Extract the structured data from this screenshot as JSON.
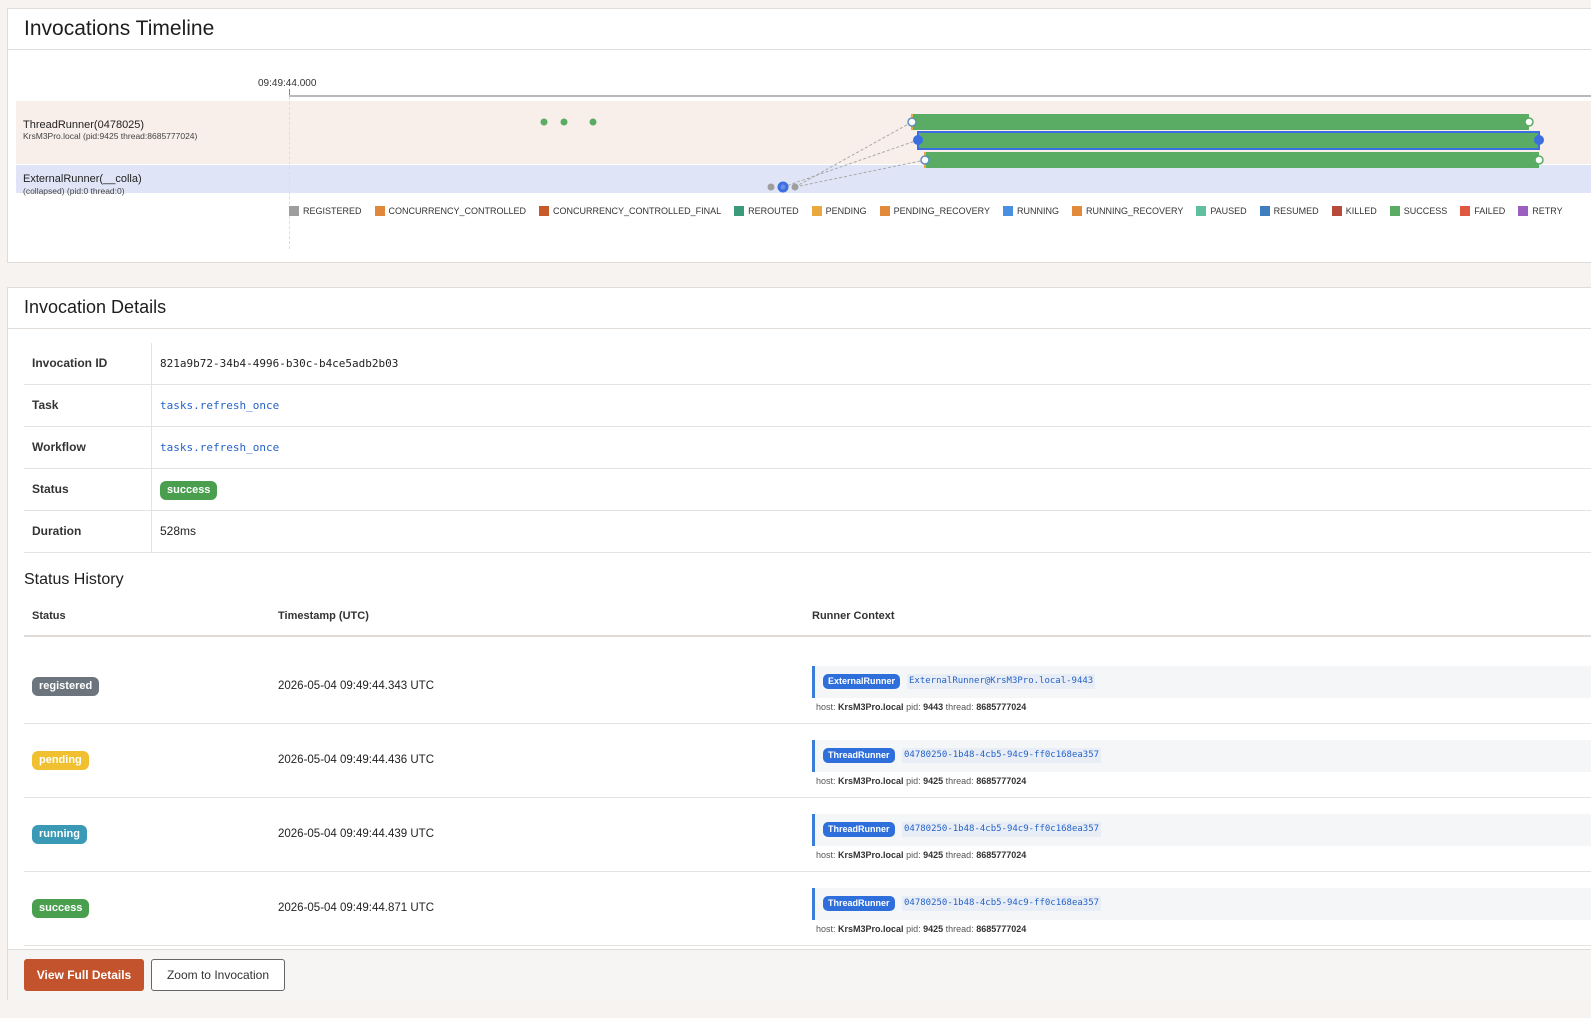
{
  "timeline": {
    "title": "Invocations Timeline",
    "start_time_label": "09:49:44.000",
    "lanes": [
      {
        "title": "ThreadRunner(0478025)",
        "subtitle": "KrsM3Pro.local (pid:9425 thread:8685777024)"
      },
      {
        "title": "ExternalRunner(__colla)",
        "subtitle": "(collapsed) (pid:0 thread:0)"
      }
    ],
    "legend": [
      {
        "label": "REGISTERED",
        "color": "#9e9e9e"
      },
      {
        "label": "CONCURRENCY_CONTROLLED",
        "color": "#e0883a"
      },
      {
        "label": "CONCURRENCY_CONTROLLED_FINAL",
        "color": "#c65a28"
      },
      {
        "label": "REROUTED",
        "color": "#3a9a7a"
      },
      {
        "label": "PENDING",
        "color": "#e9a93f"
      },
      {
        "label": "PENDING_RECOVERY",
        "color": "#e08a3a"
      },
      {
        "label": "RUNNING",
        "color": "#4a90e2"
      },
      {
        "label": "RUNNING_RECOVERY",
        "color": "#e08a3a"
      },
      {
        "label": "PAUSED",
        "color": "#5fbf9f"
      },
      {
        "label": "RESUMED",
        "color": "#3f7fbf"
      },
      {
        "label": "KILLED",
        "color": "#b84a3a"
      },
      {
        "label": "SUCCESS",
        "color": "#5aab63"
      },
      {
        "label": "FAILED",
        "color": "#e0583f"
      },
      {
        "label": "RETRY",
        "color": "#9a5fbf"
      }
    ]
  },
  "details": {
    "title": "Invocation Details",
    "fields": [
      {
        "key": "Invocation ID",
        "value": "821a9b72-34b4-4996-b30c-b4ce5adb2b03"
      },
      {
        "key": "Task",
        "value": "tasks.refresh_once"
      },
      {
        "key": "Workflow",
        "value": "tasks.refresh_once"
      },
      {
        "key": "Status",
        "value": "success",
        "color": "#4a9f4f"
      },
      {
        "key": "Duration",
        "value": "528ms"
      }
    ]
  },
  "history": {
    "title": "Status History",
    "columns": [
      "Status",
      "Timestamp (UTC)",
      "Runner Context"
    ],
    "rows": [
      {
        "status": "registered",
        "color": "#6c757d",
        "timestamp": "2026-05-04 09:49:44.343 UTC",
        "runner": "ExternalRunner",
        "runner_id": "ExternalRunner@KrsM3Pro.local-9443",
        "host_label": "host:",
        "host": "KrsM3Pro.local",
        "pid_label": "pid:",
        "pid": "9443",
        "thread_label": "thread:",
        "thread": "8685777024"
      },
      {
        "status": "pending",
        "color": "#f0c030",
        "timestamp": "2026-05-04 09:49:44.436 UTC",
        "runner": "ThreadRunner",
        "runner_id": "04780250-1b48-4cb5-94c9-ff0c168ea357",
        "host_label": "host:",
        "host": "KrsM3Pro.local",
        "pid_label": "pid:",
        "pid": "9425",
        "thread_label": "thread:",
        "thread": "8685777024"
      },
      {
        "status": "running",
        "color": "#3a9ab5",
        "timestamp": "2026-05-04 09:49:44.439 UTC",
        "runner": "ThreadRunner",
        "runner_id": "04780250-1b48-4cb5-94c9-ff0c168ea357",
        "host_label": "host:",
        "host": "KrsM3Pro.local",
        "pid_label": "pid:",
        "pid": "9425",
        "thread_label": "thread:",
        "thread": "8685777024"
      },
      {
        "status": "success",
        "color": "#4a9f4f",
        "timestamp": "2026-05-04 09:49:44.871 UTC",
        "runner": "ThreadRunner",
        "runner_id": "04780250-1b48-4cb5-94c9-ff0c168ea357",
        "host_label": "host:",
        "host": "KrsM3Pro.local",
        "pid_label": "pid:",
        "pid": "9425",
        "thread_label": "thread:",
        "thread": "8685777024"
      }
    ]
  },
  "actions": {
    "view_full_details": "View Full Details",
    "zoom_to_invocation": "Zoom to Invocation"
  }
}
